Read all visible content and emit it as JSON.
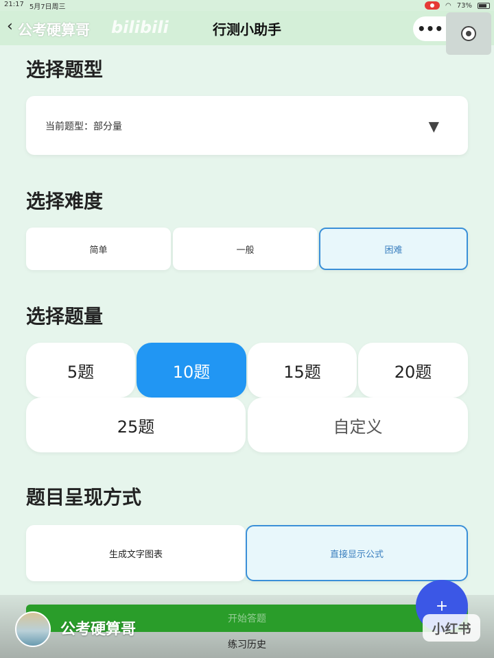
{
  "status_bar": {
    "time": "21:17",
    "date": "5月7日周三",
    "battery": "73%"
  },
  "nav": {
    "title": "行测小助手",
    "watermark": "公考硬算哥",
    "brand_watermark": "bilibili",
    "more_label": "•••"
  },
  "type_section": {
    "title": "选择题型",
    "current_label": "当前题型：部分量",
    "dropdown_arrow": "▼"
  },
  "difficulty_section": {
    "title": "选择难度",
    "options": [
      "简单",
      "一般",
      "困难"
    ],
    "selected": "困难"
  },
  "quantity_section": {
    "title": "选择题量",
    "options": [
      "5题",
      "10题",
      "15题",
      "20题",
      "25题",
      "自定义"
    ],
    "selected": "10题"
  },
  "mode_section": {
    "title": "题目呈现方式",
    "options": [
      "生成文字图表",
      "直接显示公式"
    ],
    "selected": "直接显示公式"
  },
  "actions": {
    "start_label": "开始答题",
    "history_label": "练习历史",
    "fab_label": "+"
  },
  "overlay": {
    "author": "公考硬算哥",
    "platform_logo": "小红书"
  },
  "colors": {
    "background": "#e6f5ec",
    "accent_blue": "#2196f3",
    "selected_border": "#3a8fd8",
    "start_green": "#2a9d2a",
    "fab": "#3b57e6"
  }
}
